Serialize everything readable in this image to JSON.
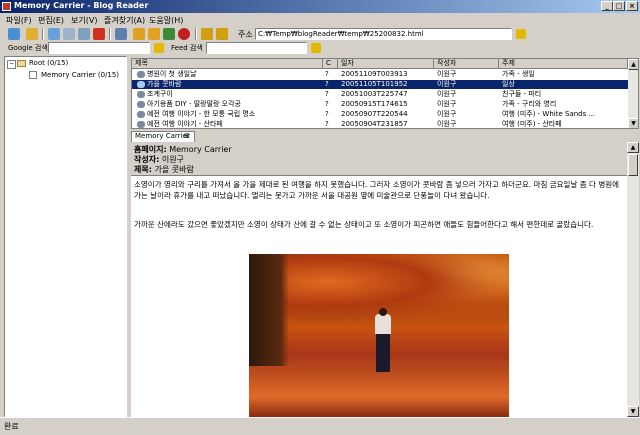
{
  "window": {
    "title": "Memory Carrier - Blog Reader"
  },
  "menu": [
    "파일(F)",
    "편집(E)",
    "보기(V)",
    "즐겨찾기(A)",
    "도움말(H)"
  ],
  "address": {
    "label": "주소",
    "value": "C:₩Temp₩blogReader₩temp₩25200832.html"
  },
  "google": {
    "label": "Google 검색",
    "value": ""
  },
  "feed": {
    "label": "Feed 검색",
    "value": ""
  },
  "tree": {
    "root": "Root (0/15)",
    "child": "Memory Carrier (0/15)"
  },
  "list": {
    "columns": [
      "제목",
      "C",
      "일자",
      "작성자",
      "주제"
    ],
    "rows": [
      {
        "title": "병원이 첫 생일날",
        "c": "?",
        "date": "20051109T003913",
        "author": "이원구",
        "topic": "가족 - 생일",
        "selected": false
      },
      {
        "title": "가을 콧바람",
        "c": "?",
        "date": "20051105T101952",
        "author": "이원구",
        "topic": "일상",
        "selected": true
      },
      {
        "title": "조계구이",
        "c": "?",
        "date": "20051003T225747",
        "author": "이원구",
        "topic": "친구들 - 파티",
        "selected": false
      },
      {
        "title": "아기용품 DIY - 딸랑딸랑 오각공",
        "c": "?",
        "date": "20050915T174615",
        "author": "이원구",
        "topic": "가족 - 구리와 영리",
        "selected": false
      },
      {
        "title": "예전 여행 이야기 - 한 모퉁 국립 명소",
        "c": "?",
        "date": "20050907T220544",
        "author": "이원구",
        "topic": "여행 (미주) - White Sands ...",
        "selected": false
      },
      {
        "title": "예전 여행 이야기 - 산타페",
        "c": "?",
        "date": "20050904T231857",
        "author": "이원구",
        "topic": "여행 (미주) - 산타페",
        "selected": false
      }
    ]
  },
  "tab": {
    "label": "Memory Carrier"
  },
  "post": {
    "homepage_label": "홈페이지:",
    "homepage": "Memory Carrier",
    "author_label": "작성자:",
    "author": "이원구",
    "title_label": "제목:",
    "title": "가을 콧바람",
    "para1": "소영이가 영리와 구리를 가져서 올 가을 제대로 된 여행을 하지 못했습니다. 그러자 소영이가 콧바람 좀 넣으러 가자고 하더군요. 마침 금요일날 좀 다 병원에 가는 날이라 휴가를 내고 떠났습니다. 멀리는 못가고 가까운 서울 대공원 옆에 미술관으로 단풍놀이 다녀 왔습니다.",
    "para2": "가까운 산에라도 갔으면 좋았겠지만 소영이 상태가 산에 갈 수 없는 상태이고 또 소영이가 피곤하면 애들도 힘들어한다고 해서 편한데로 골랐습니다."
  },
  "status": "완료",
  "colors": {
    "title_start": "#0a246a",
    "title_end": "#a6caf0",
    "selection": "#0a246a",
    "chrome": "#d4d0c8"
  }
}
